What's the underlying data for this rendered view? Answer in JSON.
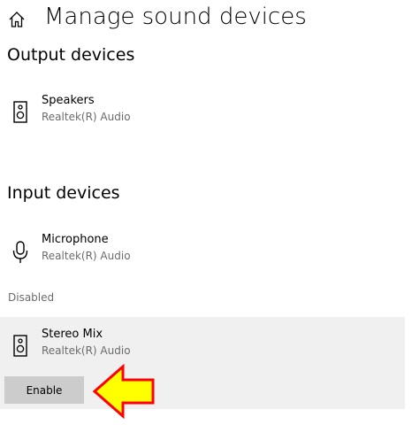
{
  "header": {
    "title": "Manage sound devices",
    "home_icon": "home-icon"
  },
  "output_section": {
    "title": "Output devices",
    "devices": [
      {
        "name": "Speakers",
        "driver": "Realtek(R) Audio",
        "icon": "speaker-icon"
      }
    ]
  },
  "input_section": {
    "title": "Input devices",
    "devices": [
      {
        "name": "Microphone",
        "driver": "Realtek(R) Audio",
        "icon": "microphone-icon"
      }
    ],
    "disabled_label": "Disabled",
    "disabled_devices": [
      {
        "name": "Stereo Mix",
        "driver": "Realtek(R) Audio",
        "icon": "speaker-icon",
        "action_label": "Enable"
      }
    ]
  },
  "annotation": {
    "arrow_fill": "#ffff00",
    "arrow_stroke": "#ff0000"
  }
}
